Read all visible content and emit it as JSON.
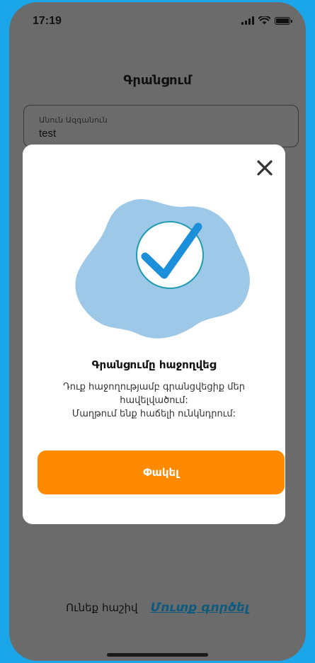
{
  "status_bar": {
    "time": "17:19"
  },
  "screen": {
    "title": "Գրանցում",
    "name_field": {
      "label": "Անուն Ազգանուն",
      "value": "test"
    }
  },
  "modal": {
    "title": "Գրանցումը հաջողվեց",
    "message_line1": "Դուք հաջողությամբ գրանցվեցիք մեր",
    "message_line2": "հավելվածում:",
    "message_line3": "Մաղթում ենք հաճելի ունկնդրում:",
    "button_label": "Փակել"
  },
  "footer": {
    "prompt": "Ունեք հաշիվ",
    "login_link": "Մուտք գործել"
  },
  "colors": {
    "background": "#1aa6e8",
    "overlay": "#6b6b6b",
    "accent": "#ff8a00",
    "link": "#0d5a7d",
    "illustration_blob": "#9dc8e8",
    "check": "#1b8fd9"
  },
  "icons": [
    "close-icon",
    "success-check-icon",
    "wifi-icon",
    "signal-icon",
    "battery-icon"
  ]
}
